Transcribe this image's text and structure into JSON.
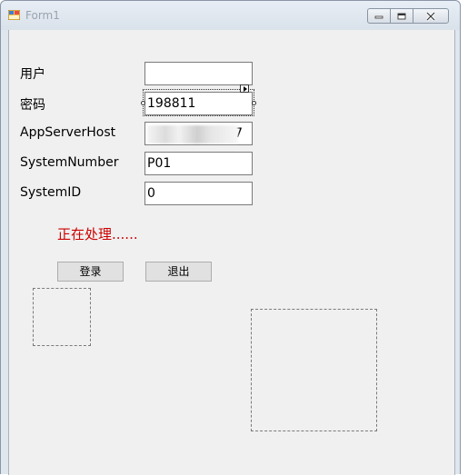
{
  "window": {
    "title": "Form1"
  },
  "form": {
    "user_label": "用户",
    "user_value": "",
    "password_label": "密码",
    "password_value": "198811",
    "host_label": "AppServerHost",
    "host_value": "7",
    "sysnum_label": "SystemNumber",
    "sysnum_value": "P01",
    "sysid_label": "SystemID",
    "sysid_value": "0"
  },
  "status_text": "正在处理......",
  "buttons": {
    "login": "登录",
    "exit": "退出"
  },
  "colors": {
    "status": "#cc0000",
    "client_bg": "#f0f0f0"
  }
}
